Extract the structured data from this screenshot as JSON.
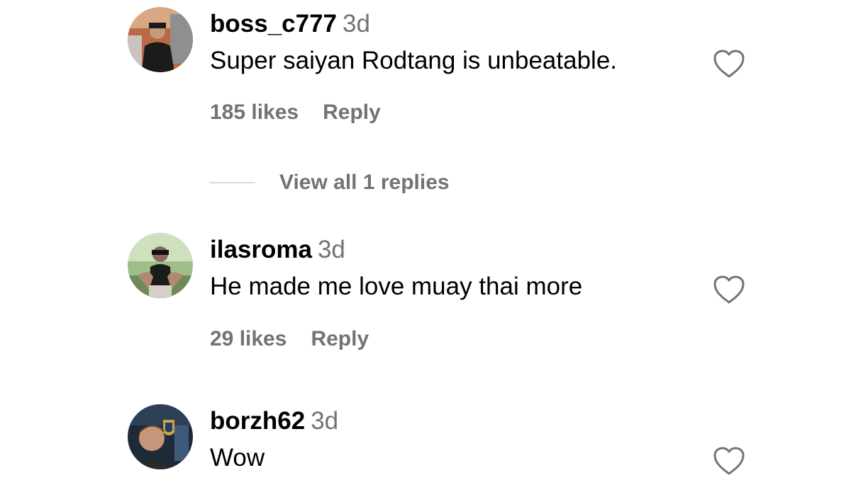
{
  "comments": [
    {
      "username": "boss_c777",
      "time": "3d",
      "text": "Super saiyan Rodtang is unbeatable.",
      "likes": "185 likes",
      "reply_label": "Reply",
      "avatar_icon": "user-avatar"
    },
    {
      "username": "ilasroma",
      "time": "3d",
      "text": "He made me love muay thai more",
      "likes": "29 likes",
      "reply_label": "Reply",
      "avatar_icon": "user-avatar"
    },
    {
      "username": "borzh62",
      "time": "3d",
      "text": "Wow",
      "avatar_icon": "user-avatar"
    }
  ],
  "view_replies": {
    "label": "View all 1 replies"
  },
  "icons": {
    "like": "heart-outline-icon"
  },
  "colors": {
    "secondary_text": "#737373",
    "primary_text": "#000000",
    "divider": "#d9d9d9"
  }
}
